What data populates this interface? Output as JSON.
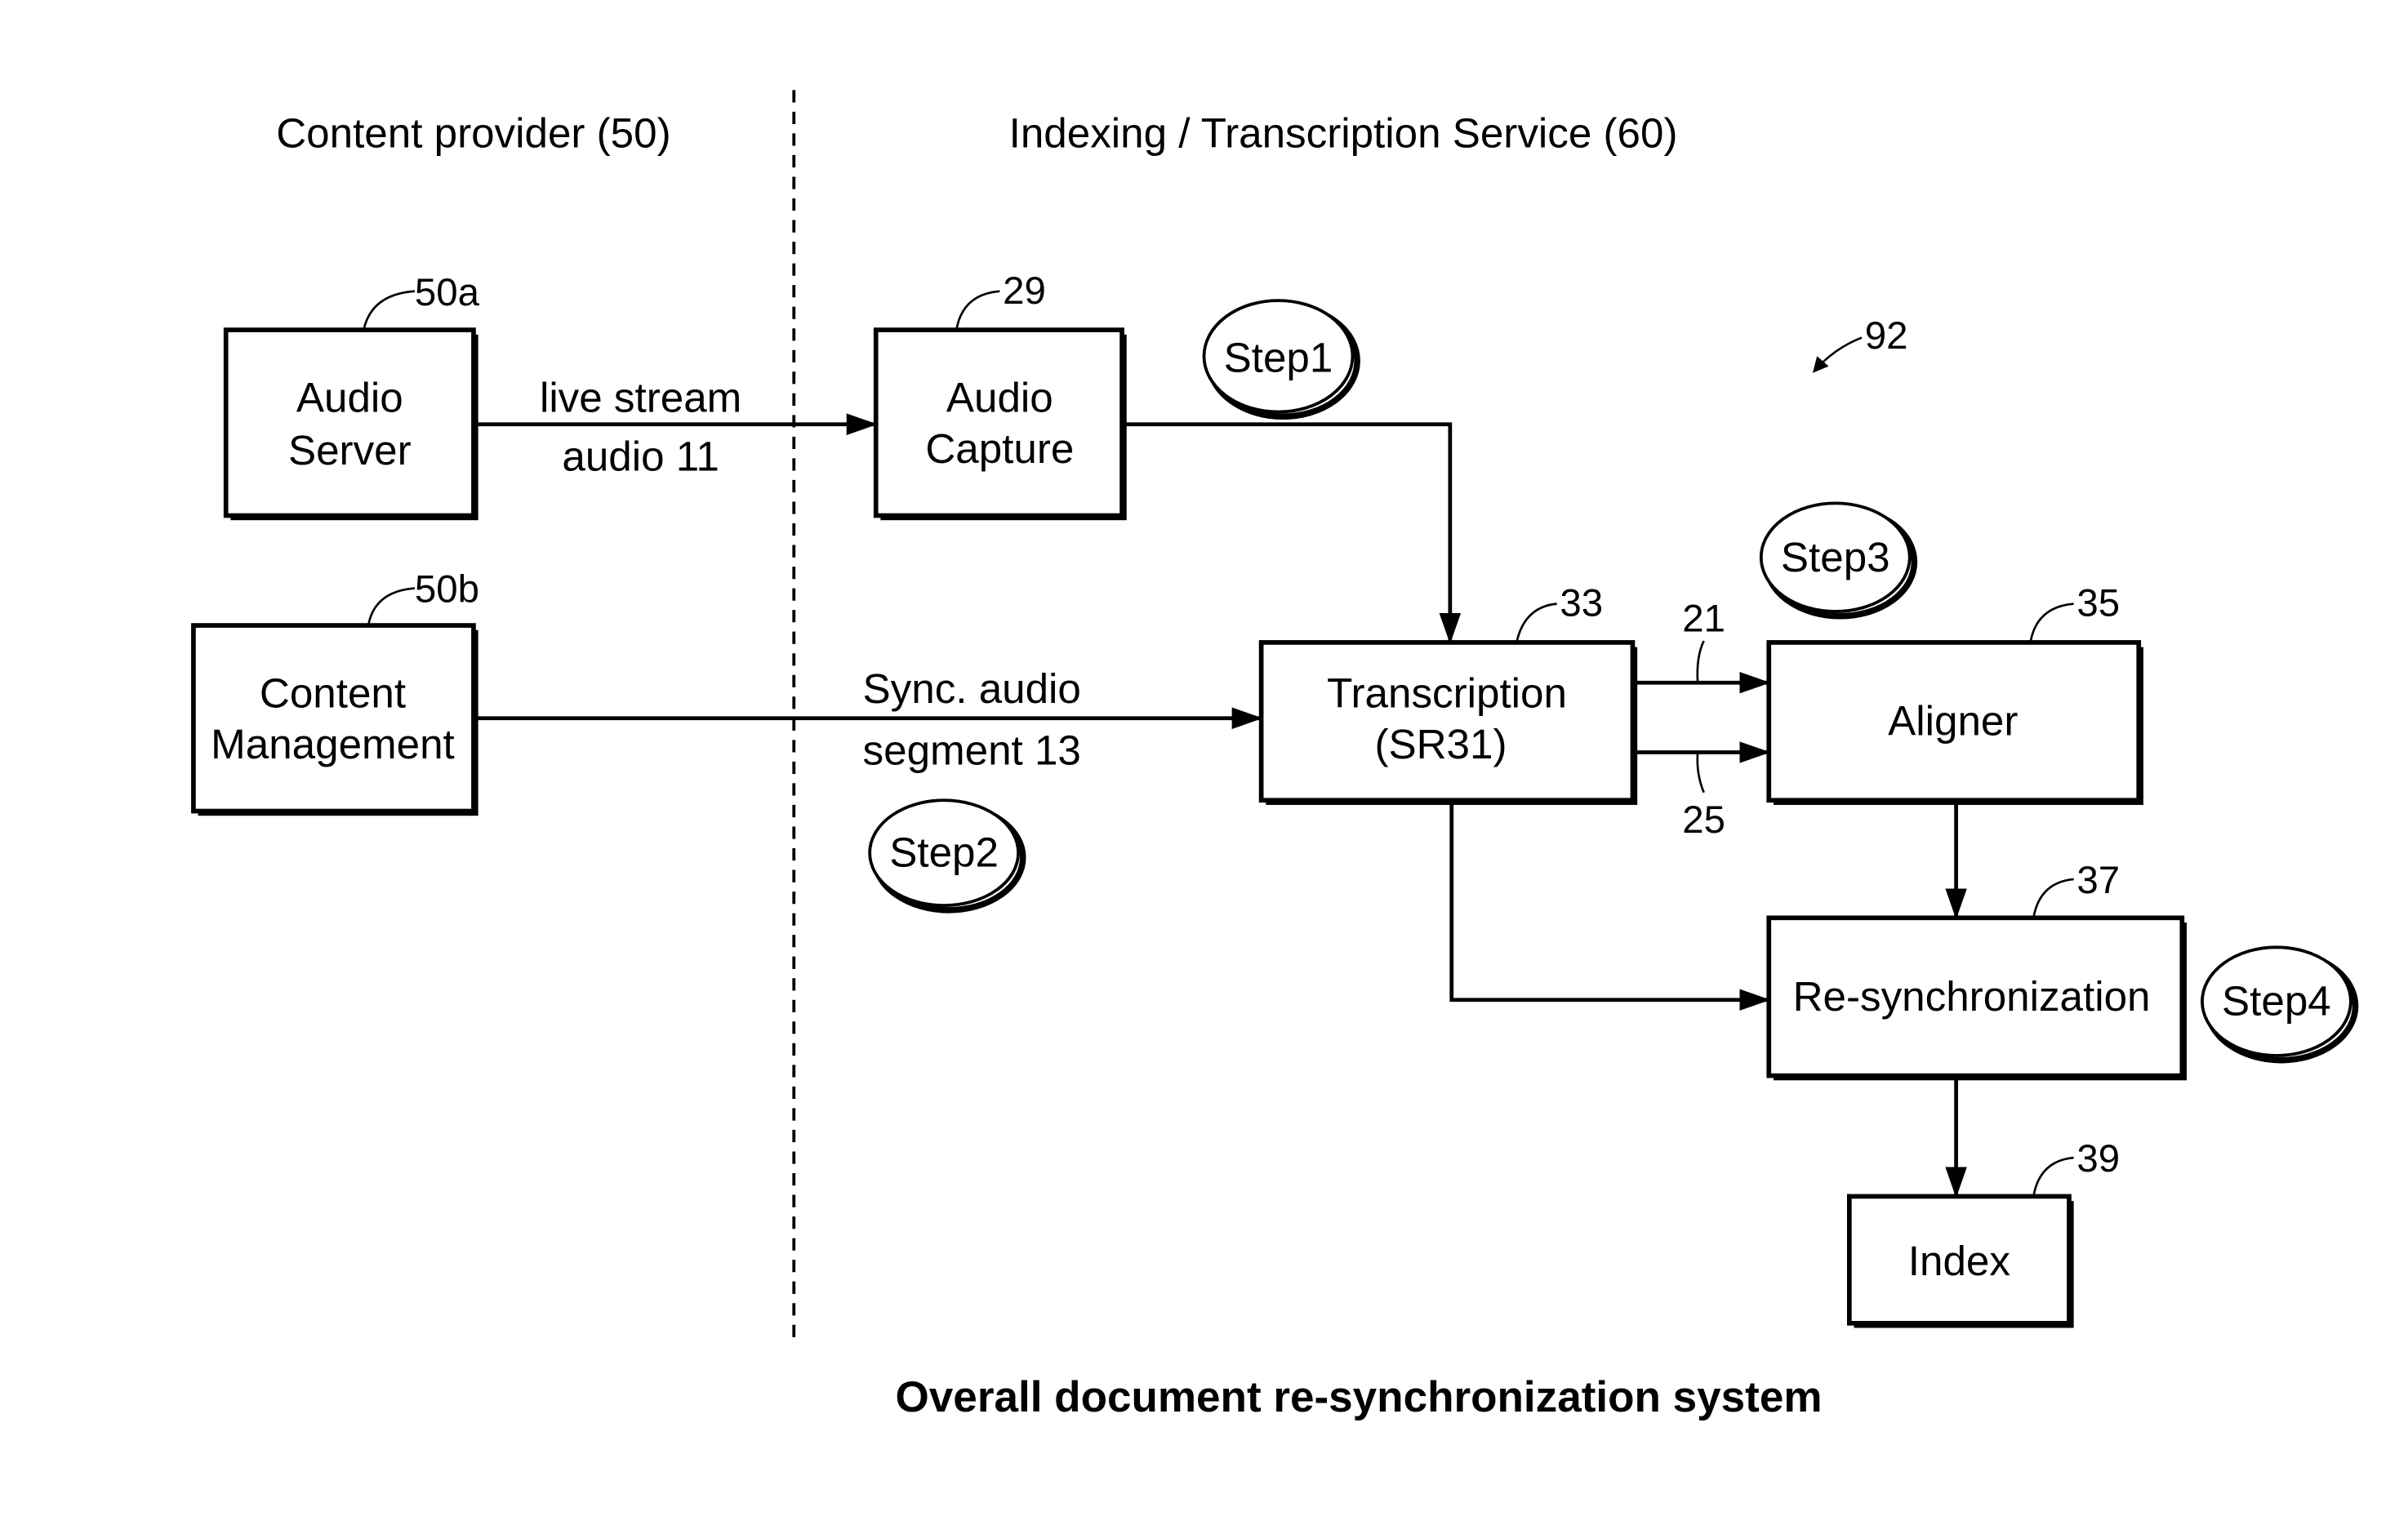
{
  "diagram": {
    "caption": "Overall document re-synchronization system",
    "figure_ref": "92",
    "regions": {
      "left": "Content provider (50)",
      "right": "Indexing / Transcription Service (60)"
    },
    "blocks": {
      "audio_server": {
        "lines": [
          "Audio",
          "Server"
        ],
        "ref": "50a"
      },
      "content_management": {
        "lines": [
          "Content",
          "Management"
        ],
        "ref": "50b"
      },
      "audio_capture": {
        "lines": [
          "Audio",
          "Capture"
        ],
        "ref": "29"
      },
      "transcription": {
        "lines": [
          "Transcription",
          "(SR31)"
        ],
        "ref": "33"
      },
      "aligner": {
        "lines": [
          "Aligner"
        ],
        "ref": "35"
      },
      "resync": {
        "lines": [
          "Re-synchronization"
        ],
        "ref": "37"
      },
      "index": {
        "lines": [
          "Index"
        ],
        "ref": "39"
      }
    },
    "edges": {
      "live_stream": {
        "lines": [
          "live stream",
          "audio 11"
        ]
      },
      "sync_audio": {
        "lines": [
          "Sync. audio",
          "segment 13"
        ]
      },
      "upper_link_ref": "21",
      "lower_link_ref": "25"
    },
    "steps": [
      "Step1",
      "Step2",
      "Step3",
      "Step4"
    ]
  }
}
